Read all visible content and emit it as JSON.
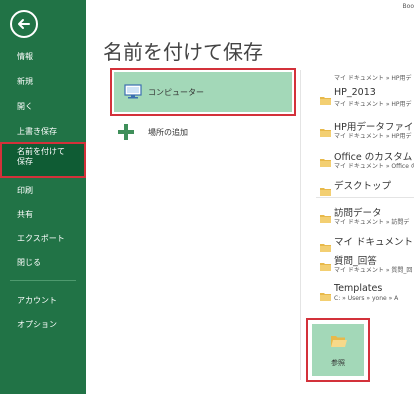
{
  "window": {
    "doc_name": "Boo"
  },
  "sidebar": {
    "items": [
      {
        "label": "情報"
      },
      {
        "label": "新規"
      },
      {
        "label": "開く"
      },
      {
        "label": "上書き保存"
      },
      {
        "label_line1": "名前を付けて",
        "label_line2": "保存"
      },
      {
        "label": "印刷"
      },
      {
        "label": "共有"
      },
      {
        "label": "エクスポート"
      },
      {
        "label": "閉じる"
      },
      {
        "label": "アカウント"
      },
      {
        "label": "オプション"
      }
    ]
  },
  "main": {
    "title": "名前を付けて保存",
    "places": [
      {
        "label": "コンピューター"
      },
      {
        "label": "場所の追加"
      }
    ],
    "recent_top_path": "マイ ドキュメント » HP用デ",
    "recent_folders": [
      {
        "name": "HP_2013",
        "path": "マイ ドキュメント » HP用デ"
      },
      {
        "name": "HP用データファイル",
        "path": "マイ ドキュメント » HP用デ"
      },
      {
        "name": "Office のカスタム テンプ",
        "path": "マイ ドキュメント » Office の"
      },
      {
        "name": "デスクトップ",
        "path": ""
      },
      {
        "name": "訪問データ",
        "path": "マイ ドキュメント » 訪問デ"
      },
      {
        "name": "マイ ドキュメント",
        "path": ""
      },
      {
        "name": "質問_回答",
        "path": "マイ ドキュメント » 質問_回"
      },
      {
        "name": "Templates",
        "path": "C: » Users » yone » A"
      }
    ],
    "browse_label": "参照"
  },
  "colors": {
    "sidebar_bg": "#217346",
    "selected_bg": "#0f5c34",
    "highlight": "#a3d8b8",
    "annotation_border": "#d3313a"
  }
}
